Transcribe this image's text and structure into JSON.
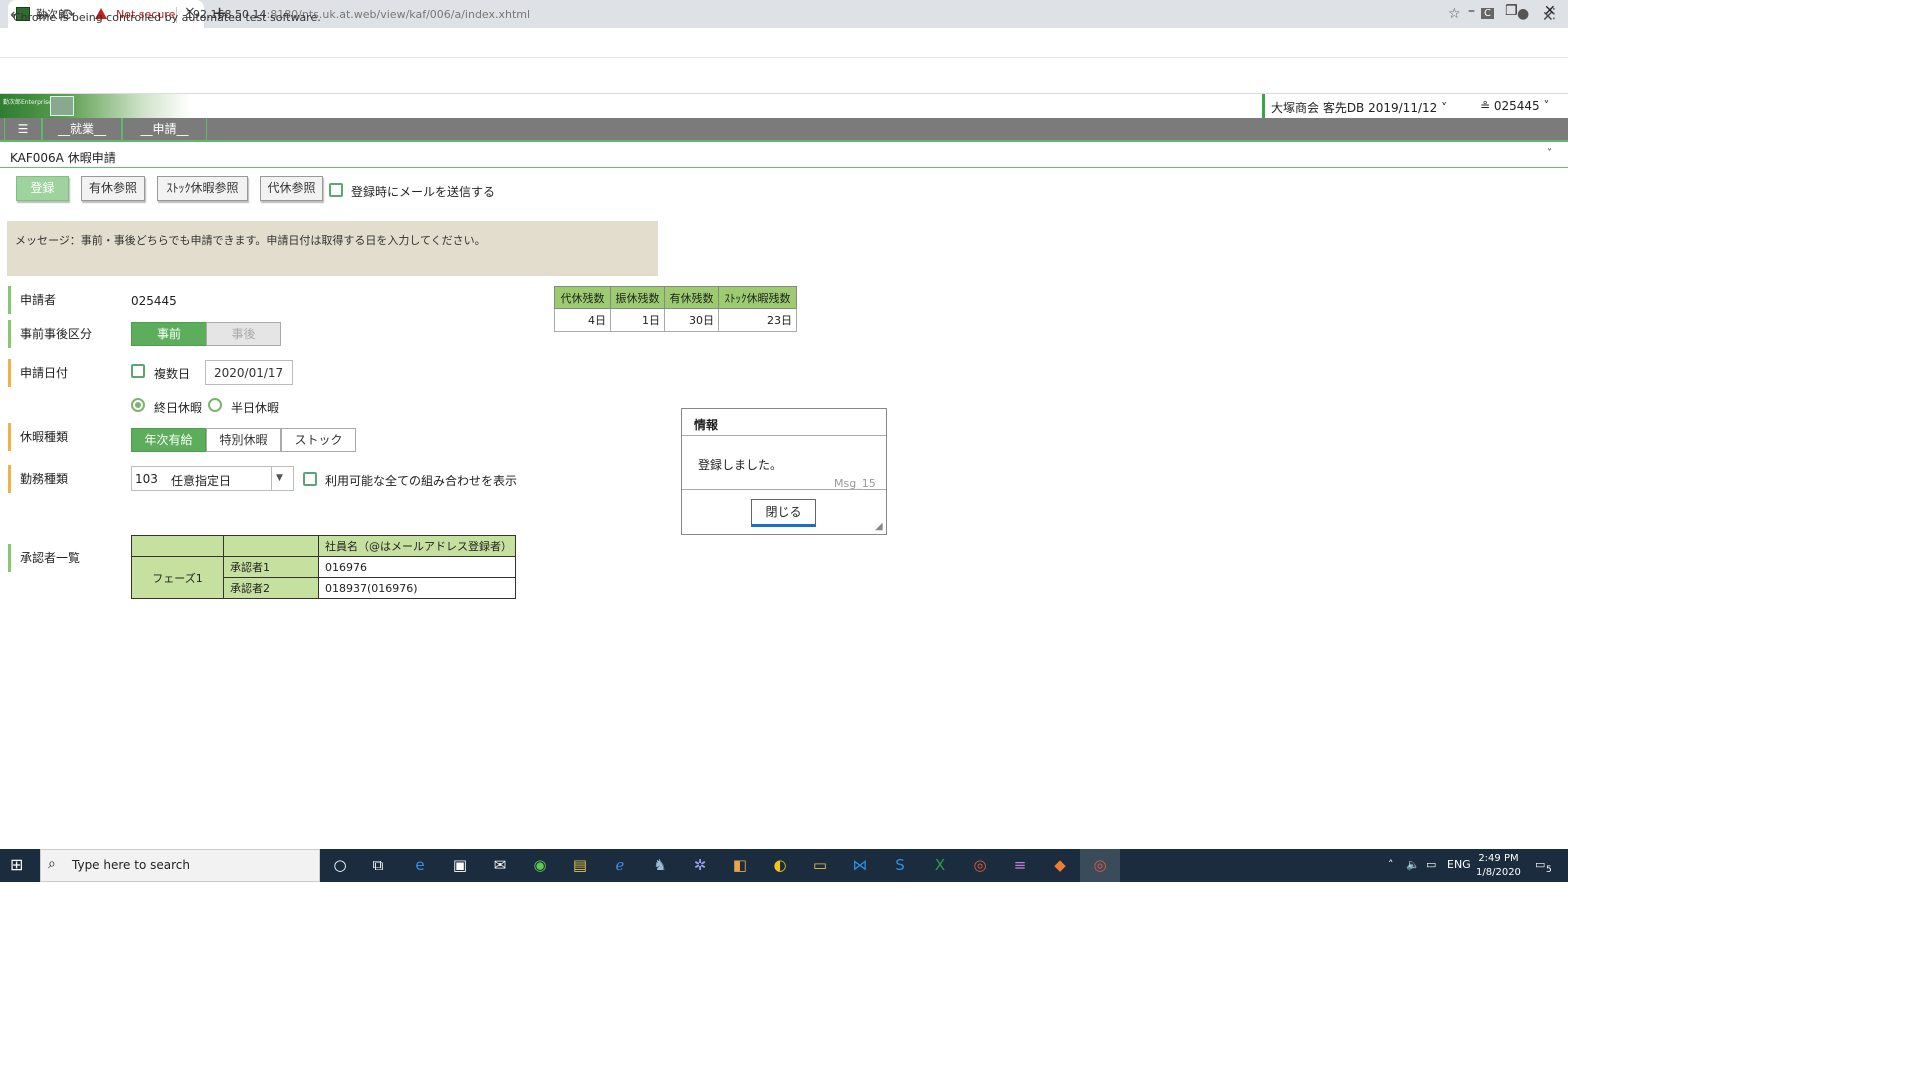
{
  "browser": {
    "tab_title": "勤次郎",
    "tab_close": "×",
    "new_tab": "+",
    "win_min": "–",
    "win_max": "❐",
    "win_close": "✕",
    "back": "←",
    "forward": "→",
    "reload": "⟳",
    "not_secure": "Not secure",
    "url_host": "192.168.50.14",
    "url_path": ":8180/nts.uk.at.web/view/kaf/006/a/index.xhtml",
    "star": "☆",
    "ext": "C",
    "profile": "●",
    "kebab": "⋮",
    "infobar_text": "Chrome is being controlled by automated test software.",
    "infobar_close": "✕"
  },
  "app": {
    "logo_text": "勤次郎Enterprise",
    "company": "大塚商会 客先DB 2019/11/12 ˅",
    "user": "≗ 025445 ˅",
    "menu": [
      "☰",
      "__就業__",
      "__申請__"
    ],
    "page_title": "KAF006A 休暇申請",
    "page_chevron": "˅"
  },
  "toolbar": {
    "register": "登録",
    "annual_ref": "有休参照",
    "stock_ref": "ｽﾄｯｸ休暇参照",
    "comp_ref": "代休参照",
    "mail_label": "登録時にメールを送信する"
  },
  "message": "メッセージ：事前・事後どちらでも申請できます。申請日付は取得する日を入力してください。",
  "form": {
    "applicant_label": "申請者",
    "applicant_value": "025445",
    "prepost_label": "事前事後区分",
    "prepost_options": [
      "事前",
      "事後"
    ],
    "date_label": "申請日付",
    "multi_day": "複数日",
    "date_value": "2020/01/17",
    "full_day": "終日休暇",
    "half_day": "半日休暇",
    "leave_type_label": "休暇種類",
    "leave_types": [
      "年次有給",
      "特別休暇",
      "ストック"
    ],
    "work_type_label": "勤務種類",
    "work_type_code": "103",
    "work_type_name": "任意指定日",
    "dropdown_arrow": "▼",
    "show_all_label": "利用可能な全ての組み合わせを表示",
    "approver_label": "承認者一覧"
  },
  "balance": {
    "headers": [
      "代休残数",
      "振休残数",
      "有休残数",
      "ｽﾄｯｸ休暇残数"
    ],
    "values": [
      "4日",
      "1日",
      "30日",
      "23日"
    ]
  },
  "approvers": {
    "header": "社員名（@はメールアドレス登録者）",
    "phase": "フェーズ1",
    "rows": [
      {
        "role": "承認者1",
        "name": "016976"
      },
      {
        "role": "承認者2",
        "name": "018937(016976)"
      }
    ]
  },
  "dialog": {
    "title": "情報",
    "message": "登録しました。",
    "code": "Msg_15",
    "close": "閉じる"
  },
  "taskbar": {
    "search_placeholder": "Type here to search",
    "lang": "ENG",
    "time": "2:49 PM",
    "date": "1/8/2020",
    "notif_count": "5"
  }
}
